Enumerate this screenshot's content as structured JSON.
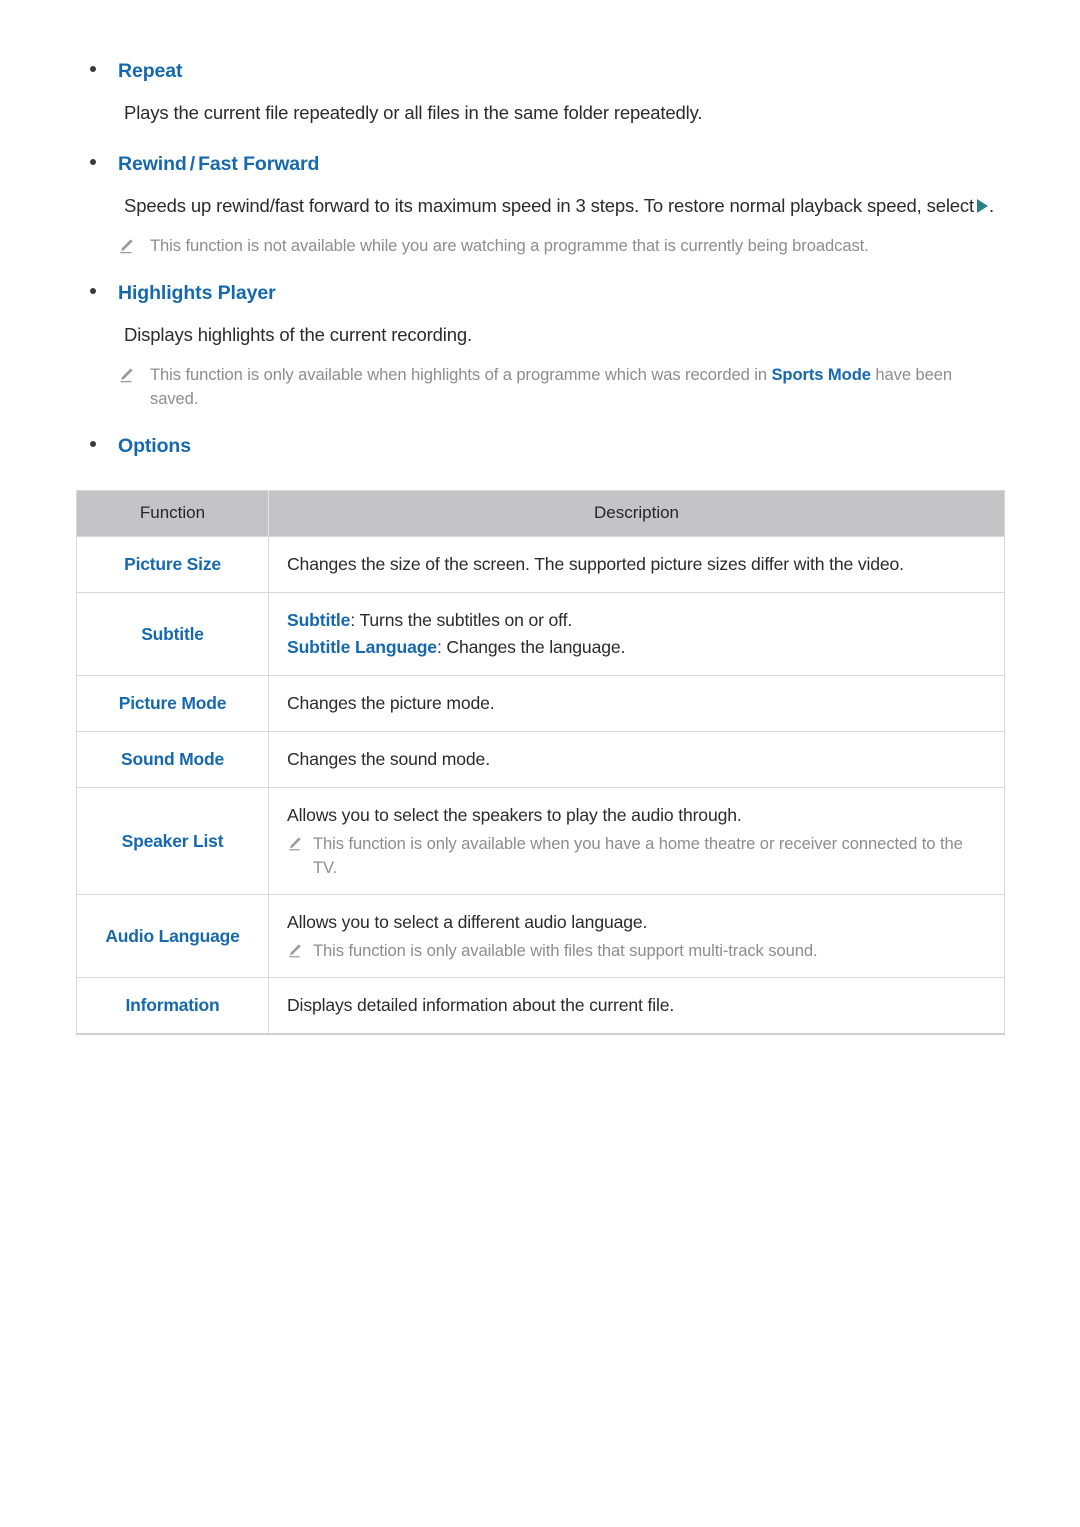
{
  "sections": [
    {
      "heading": "Repeat",
      "body": "Plays the current file repeatedly or all files in the same folder repeatedly."
    },
    {
      "heading_part1": "Rewind",
      "heading_sep": "/",
      "heading_part2": "Fast Forward",
      "body_before": "Speeds up rewind/fast forward to its maximum speed in 3 steps. To restore normal playback speed, select",
      "body_after": ".",
      "note": "This function is not available while you are watching a programme that is currently being broadcast."
    },
    {
      "heading": "Highlights Player",
      "body": "Displays highlights of the current recording.",
      "note_before": "This function is only available when highlights of a programme which was recorded in ",
      "note_highlight": "Sports Mode",
      "note_after": " have been saved."
    },
    {
      "heading": "Options"
    }
  ],
  "table": {
    "headers": [
      "Function",
      "Description"
    ],
    "rows": [
      {
        "function": "Picture Size",
        "desc_lines": [
          "Changes the size of the screen. The supported picture sizes differ with the video."
        ],
        "note": null
      },
      {
        "function": "Subtitle",
        "kw_lines": [
          {
            "kw": "Subtitle",
            "rest": ": Turns the subtitles on or off."
          },
          {
            "kw": "Subtitle Language",
            "rest": ": Changes the language."
          }
        ],
        "note": null
      },
      {
        "function": "Picture Mode",
        "desc_lines": [
          "Changes the picture mode."
        ],
        "note": null
      },
      {
        "function": "Sound Mode",
        "desc_lines": [
          "Changes the sound mode."
        ],
        "note": null
      },
      {
        "function": "Speaker List",
        "desc_lines": [
          "Allows you to select the speakers to play the audio through."
        ],
        "note": "This function is only available when you have a home theatre or receiver connected to the TV."
      },
      {
        "function": "Audio Language",
        "desc_lines": [
          "Allows you to select a different audio language."
        ],
        "note": "This function is only available with files that support multi-track sound."
      },
      {
        "function": "Information",
        "desc_lines": [
          "Displays detailed information about the current file."
        ],
        "note": null
      }
    ]
  },
  "colors": {
    "heading_blue": "#1769ae",
    "note_gray": "#8d8d8d",
    "body_text": "#2b2b2b",
    "table_header_bg": "#c4c4c6",
    "play_icon_teal": "#2a7f86"
  },
  "icons": {
    "note": "pencil-icon",
    "play": "play-triangle-icon",
    "bullet": "bullet-dot-icon"
  }
}
